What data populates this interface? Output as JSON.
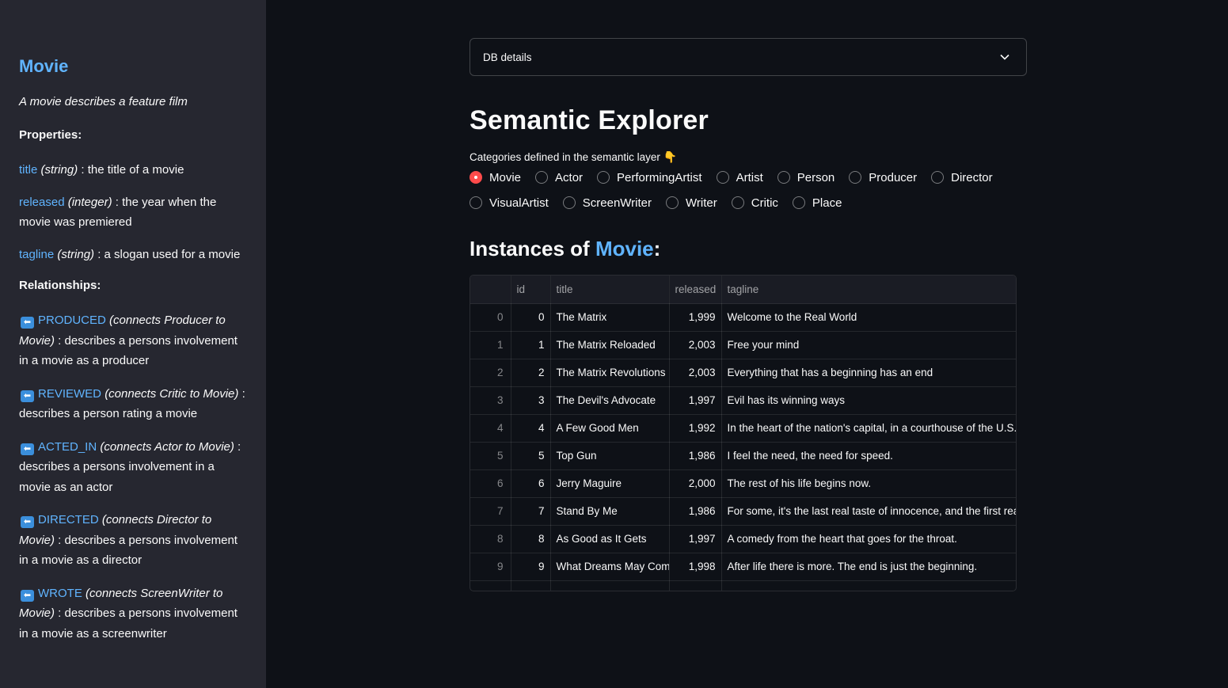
{
  "sidebar": {
    "title": "Movie",
    "description": "A movie describes a feature film",
    "properties_heading": "Properties:",
    "properties": [
      {
        "name": "title",
        "type": "(string)",
        "desc": " : the title of a movie"
      },
      {
        "name": "released",
        "type": "(integer)",
        "desc": " : the year when the movie was premiered"
      },
      {
        "name": "tagline",
        "type": "(string)",
        "desc": " : a slogan used for a movie"
      }
    ],
    "relationships_heading": "Relationships:",
    "relationships": [
      {
        "name": "PRODUCED",
        "connects": "(connects Producer to Movie)",
        "desc": " : describes a persons involvement in a movie as a producer"
      },
      {
        "name": "REVIEWED",
        "connects": "(connects Critic to Movie)",
        "desc": " : describes a person rating a movie"
      },
      {
        "name": "ACTED_IN",
        "connects": "(connects Actor to Movie)",
        "desc": " : describes a persons involvement in a movie as an actor"
      },
      {
        "name": "DIRECTED",
        "connects": "(connects Director to Movie)",
        "desc": " : describes a persons involvement in a movie as a director"
      },
      {
        "name": "WROTE",
        "connects": "(connects ScreenWriter to Movie)",
        "desc": " : describes a persons involvement in a movie as a screenwriter"
      }
    ],
    "arrow_glyph": "⬅"
  },
  "expander": {
    "label": "DB details"
  },
  "page_title": "Semantic Explorer",
  "radio": {
    "label": "Categories defined in the semantic layer",
    "label_icon": "👇",
    "selected": "Movie",
    "options": [
      "Movie",
      "Actor",
      "PerformingArtist",
      "Artist",
      "Person",
      "Producer",
      "Director",
      "VisualArtist",
      "ScreenWriter",
      "Writer",
      "Critic",
      "Place"
    ]
  },
  "instances": {
    "prefix": "Instances of ",
    "category": "Movie",
    "suffix": ":"
  },
  "table": {
    "columns": [
      "",
      "id",
      "title",
      "released",
      "tagline"
    ],
    "rows": [
      [
        "0",
        "0",
        "The Matrix",
        "1,999",
        "Welcome to the Real World"
      ],
      [
        "1",
        "1",
        "The Matrix Reloaded",
        "2,003",
        "Free your mind"
      ],
      [
        "2",
        "2",
        "The Matrix Revolutions",
        "2,003",
        "Everything that has a beginning has an end"
      ],
      [
        "3",
        "3",
        "The Devil's Advocate",
        "1,997",
        "Evil has its winning ways"
      ],
      [
        "4",
        "4",
        "A Few Good Men",
        "1,992",
        "In the heart of the nation's capital, in a courthouse of the U.S. g"
      ],
      [
        "5",
        "5",
        "Top Gun",
        "1,986",
        "I feel the need, the need for speed."
      ],
      [
        "6",
        "6",
        "Jerry Maguire",
        "2,000",
        "The rest of his life begins now."
      ],
      [
        "7",
        "7",
        "Stand By Me",
        "1,986",
        "For some, it's the last real taste of innocence, and the first real t"
      ],
      [
        "8",
        "8",
        "As Good as It Gets",
        "1,997",
        "A comedy from the heart that goes for the throat."
      ],
      [
        "9",
        "9",
        "What Dreams May Come",
        "1,998",
        "After life there is more. The end is just the beginning."
      ]
    ]
  },
  "colors": {
    "background": "#0e1117",
    "sidebar": "#262730",
    "accent_blue": "#60b4ff",
    "radio_selected": "#ff4b4b"
  }
}
